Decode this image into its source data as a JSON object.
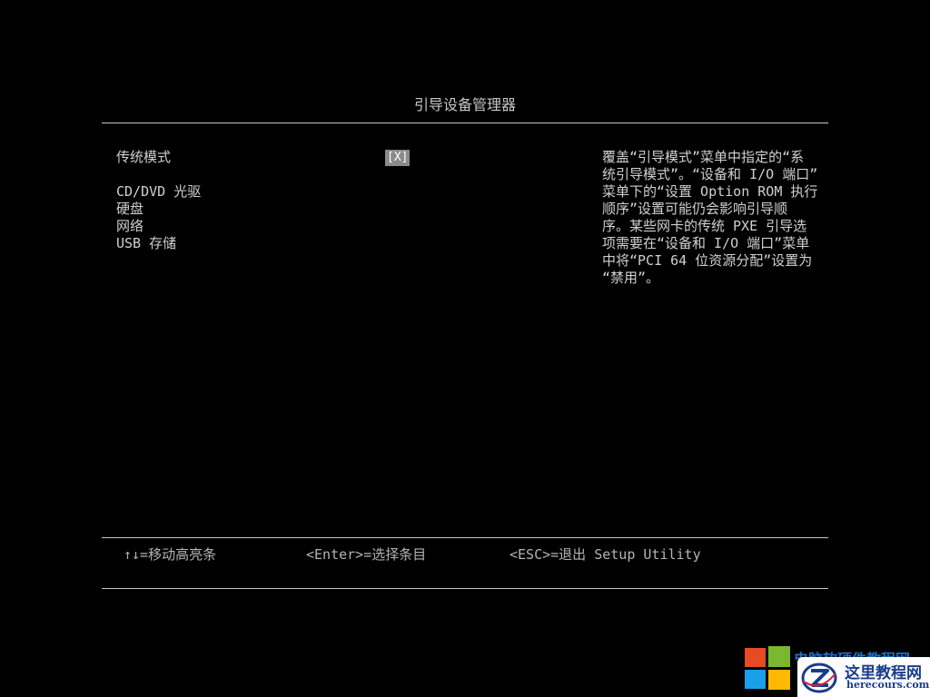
{
  "screen": {
    "title": "引导设备管理器"
  },
  "options": [
    "传统模式",
    "CD/DVD 光驱",
    "硬盘",
    "网络",
    "USB 存储"
  ],
  "legacy_mode_value": "[X]",
  "help_lines": [
    "覆盖“引导模式”菜单中指定的“系",
    "统引导模式”。“设备和 I/O 端口”",
    "菜单下的“设置 Option ROM 执行",
    "顺序”设置可能仍会影响引导顺",
    "序。某些网卡的传统 PXE 引导选",
    "项需要在“设备和 I/O 端口”菜单",
    "中将“PCI 64 位资源分配”设置为",
    "“禁用”。"
  ],
  "key_hints": {
    "move": "↑↓=移动高亮条",
    "enter": "<Enter>=选择条目",
    "esc": "<ESC>=退出 Setup Utility"
  },
  "watermark": {
    "title": "电脑软硬件教程网",
    "name": "这里教程网",
    "url": "herecours.com"
  },
  "colors": {
    "background": "#000000",
    "text": "#c8c8c8",
    "value_highlight": "#8a8a8a",
    "watermark_blue": "#1e6fc8"
  }
}
